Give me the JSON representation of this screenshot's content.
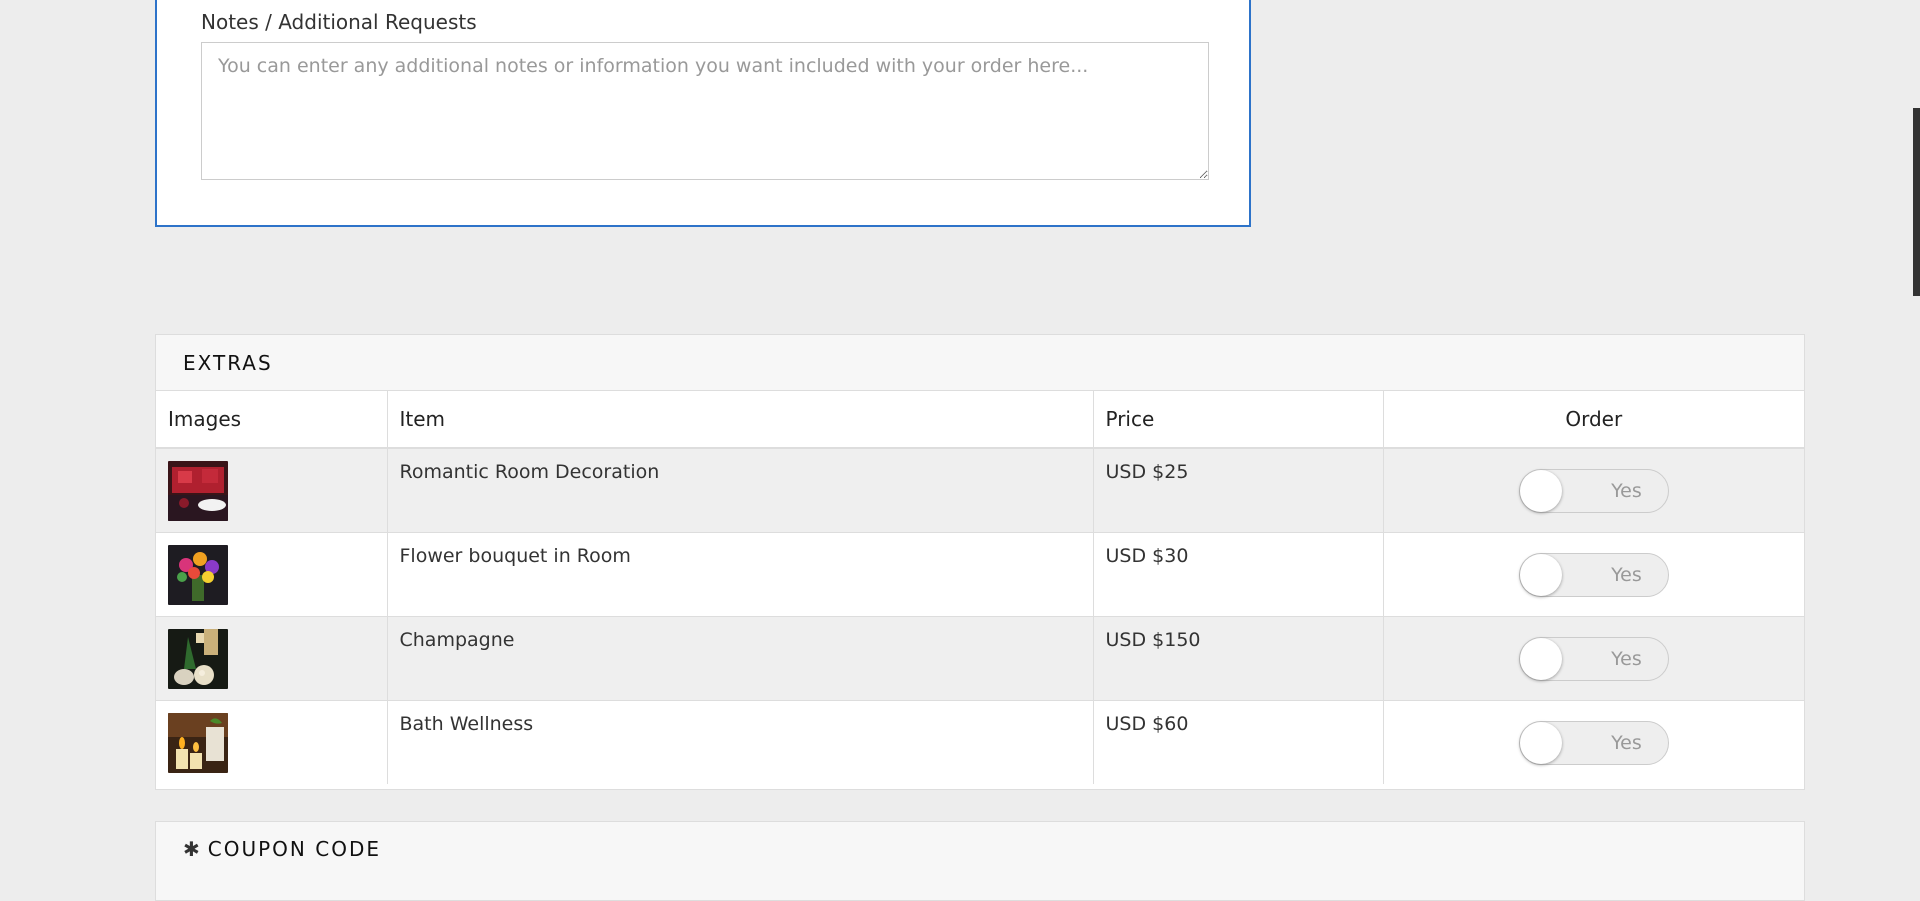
{
  "notes": {
    "label": "Notes / Additional Requests",
    "placeholder": "You can enter any additional notes or information you want included with your order here...",
    "value": ""
  },
  "extras": {
    "title": "EXTRAS",
    "columns": [
      "Images",
      "Item",
      "Price",
      "Order"
    ],
    "rows": [
      {
        "item": "Romantic Room Decoration",
        "price": "USD $25",
        "toggle_label": "Yes",
        "selected": false
      },
      {
        "item": "Flower bouquet in Room",
        "price": "USD $30",
        "toggle_label": "Yes",
        "selected": false
      },
      {
        "item": "Champagne",
        "price": "USD $150",
        "toggle_label": "Yes",
        "selected": false
      },
      {
        "item": "Bath Wellness",
        "price": "USD $60",
        "toggle_label": "Yes",
        "selected": false
      }
    ]
  },
  "coupon": {
    "icon": "asterisk-icon",
    "title": "COUPON CODE"
  },
  "colors": {
    "accent_border": "#2d73c9",
    "page_background": "#ededed"
  }
}
